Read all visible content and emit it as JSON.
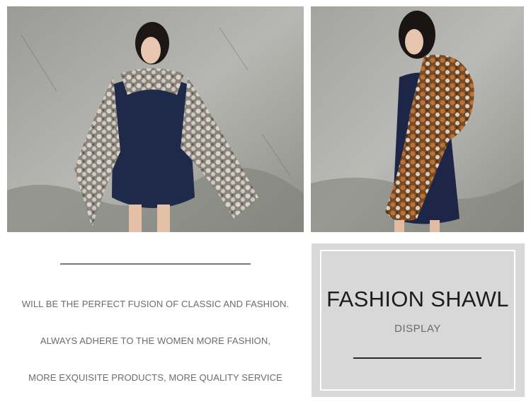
{
  "photos": {
    "left": {
      "subject": "woman-in-gray-fur-shawl"
    },
    "right": {
      "subject": "woman-in-brown-gray-fur-shawl"
    }
  },
  "copy": {
    "lines": [
      "WILL BE THE PERFECT FUSION OF CLASSIC AND FASHION.",
      "ALWAYS ADHERE TO THE WOMEN MORE FASHION,",
      "MORE EXQUISITE PRODUCTS, MORE QUALITY SERVICE"
    ]
  },
  "panel": {
    "title": "FASHION SHAWL",
    "subtitle": "DISPLAY"
  },
  "colors": {
    "panel_bg": "#d8d8d8",
    "text_gray": "#6c6c6c",
    "title_dark": "#1c1c1c"
  }
}
